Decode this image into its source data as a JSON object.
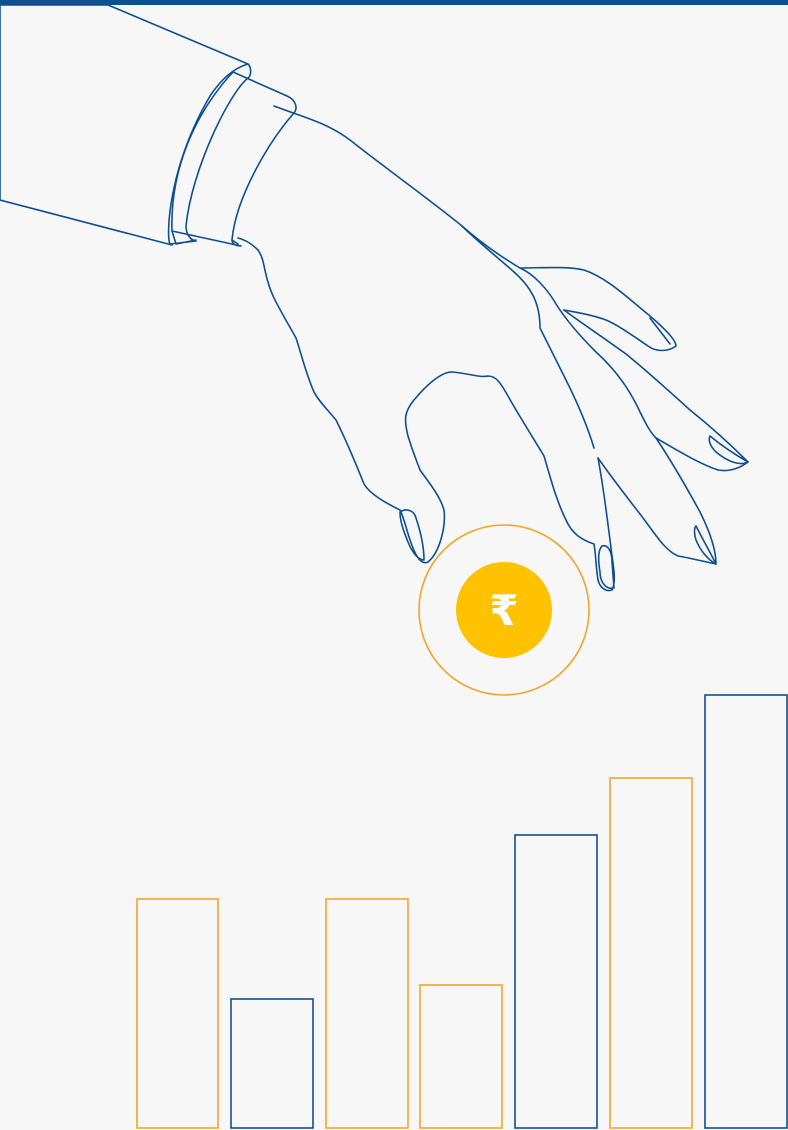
{
  "colors": {
    "background": "#f7f7f7",
    "top_strip": "#0d4f91",
    "outline_blue": "#0d4f91",
    "outline_orange": "#f2a52b",
    "coin_fill": "#ffc200",
    "coin_symbol": "#ffffff"
  },
  "coin": {
    "symbol": "₹",
    "icon": "rupee-icon"
  },
  "bars": {
    "count": 7,
    "order_colors": [
      "orange",
      "blue",
      "orange",
      "orange",
      "blue",
      "orange",
      "blue"
    ],
    "relative_heights": [
      0.231,
      0.13,
      0.231,
      0.144,
      0.294,
      0.352,
      0.435
    ]
  }
}
